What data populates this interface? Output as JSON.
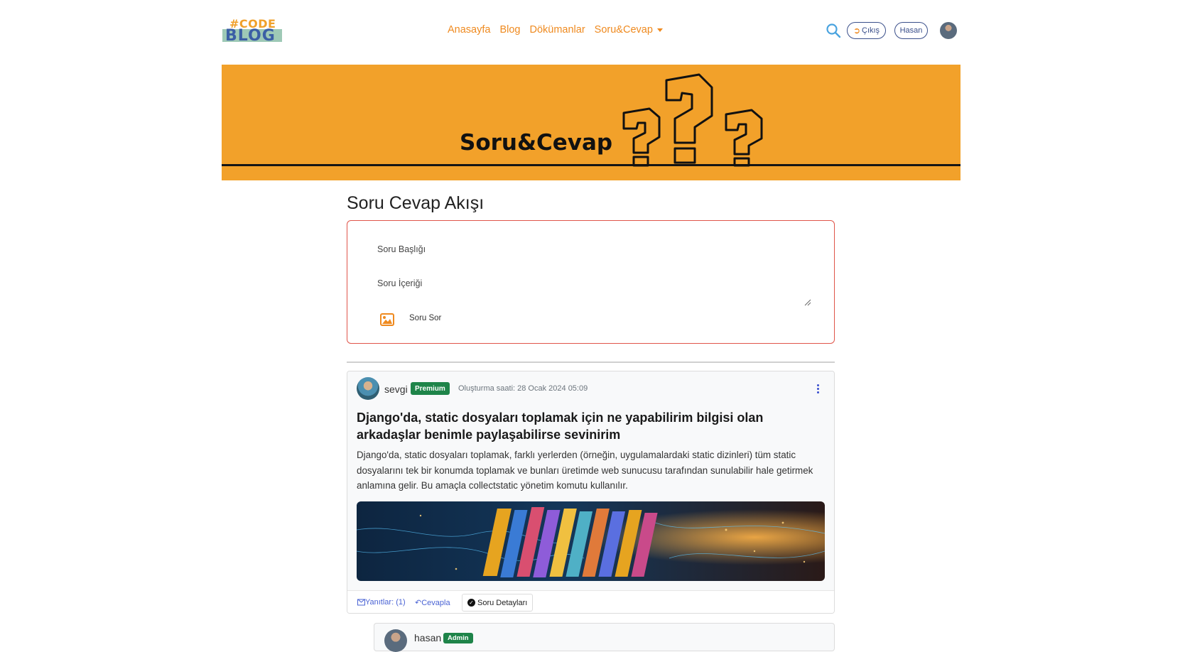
{
  "nav": {
    "logo_top": "#CODE",
    "logo_bottom": "BLOG",
    "links": [
      "Anasayfa",
      "Blog",
      "Dökümanlar",
      "Soru&Cevap"
    ],
    "logout_label": "Çıkış",
    "user_label": "Hasan"
  },
  "banner": {
    "title": "Soru&Cevap"
  },
  "main": {
    "title": "Soru Cevap Akışı",
    "form": {
      "title_placeholder": "Soru Başlığı",
      "body_placeholder": "Soru İçeriği",
      "submit_label": "Soru Sor"
    }
  },
  "post": {
    "author": "sevgi",
    "badge": "Premium",
    "meta": "Oluşturma saati: 28 Ocak 2024 05:09",
    "title": "Django'da, static dosyaları toplamak için ne yapabilirim bilgisi olan arkadaşlar benimle paylaşabilirse sevinirim",
    "text": "Django'da, static dosyaları toplamak, farklı yerlerden (örneğin, uygulamalardaki static dizinleri) tüm static dosyalarını tek bir konumda toplamak ve bunları üretimde web sunucusu tarafından sunulabilir hale getirmek anlamına gelir. Bu amaçla collectstatic yönetim komutu kullanılır.",
    "actions": {
      "replies": "Yanıtlar: (1)",
      "reply": "Cevapla",
      "details": "Soru Detayları"
    }
  },
  "reply": {
    "author": "hasan",
    "badge": "Admin"
  },
  "colors": {
    "accent": "#ef8a1f",
    "banner": "#f2a12a",
    "form_border": "#e0554a",
    "badge": "#1e8449",
    "link": "#4a63d4"
  }
}
